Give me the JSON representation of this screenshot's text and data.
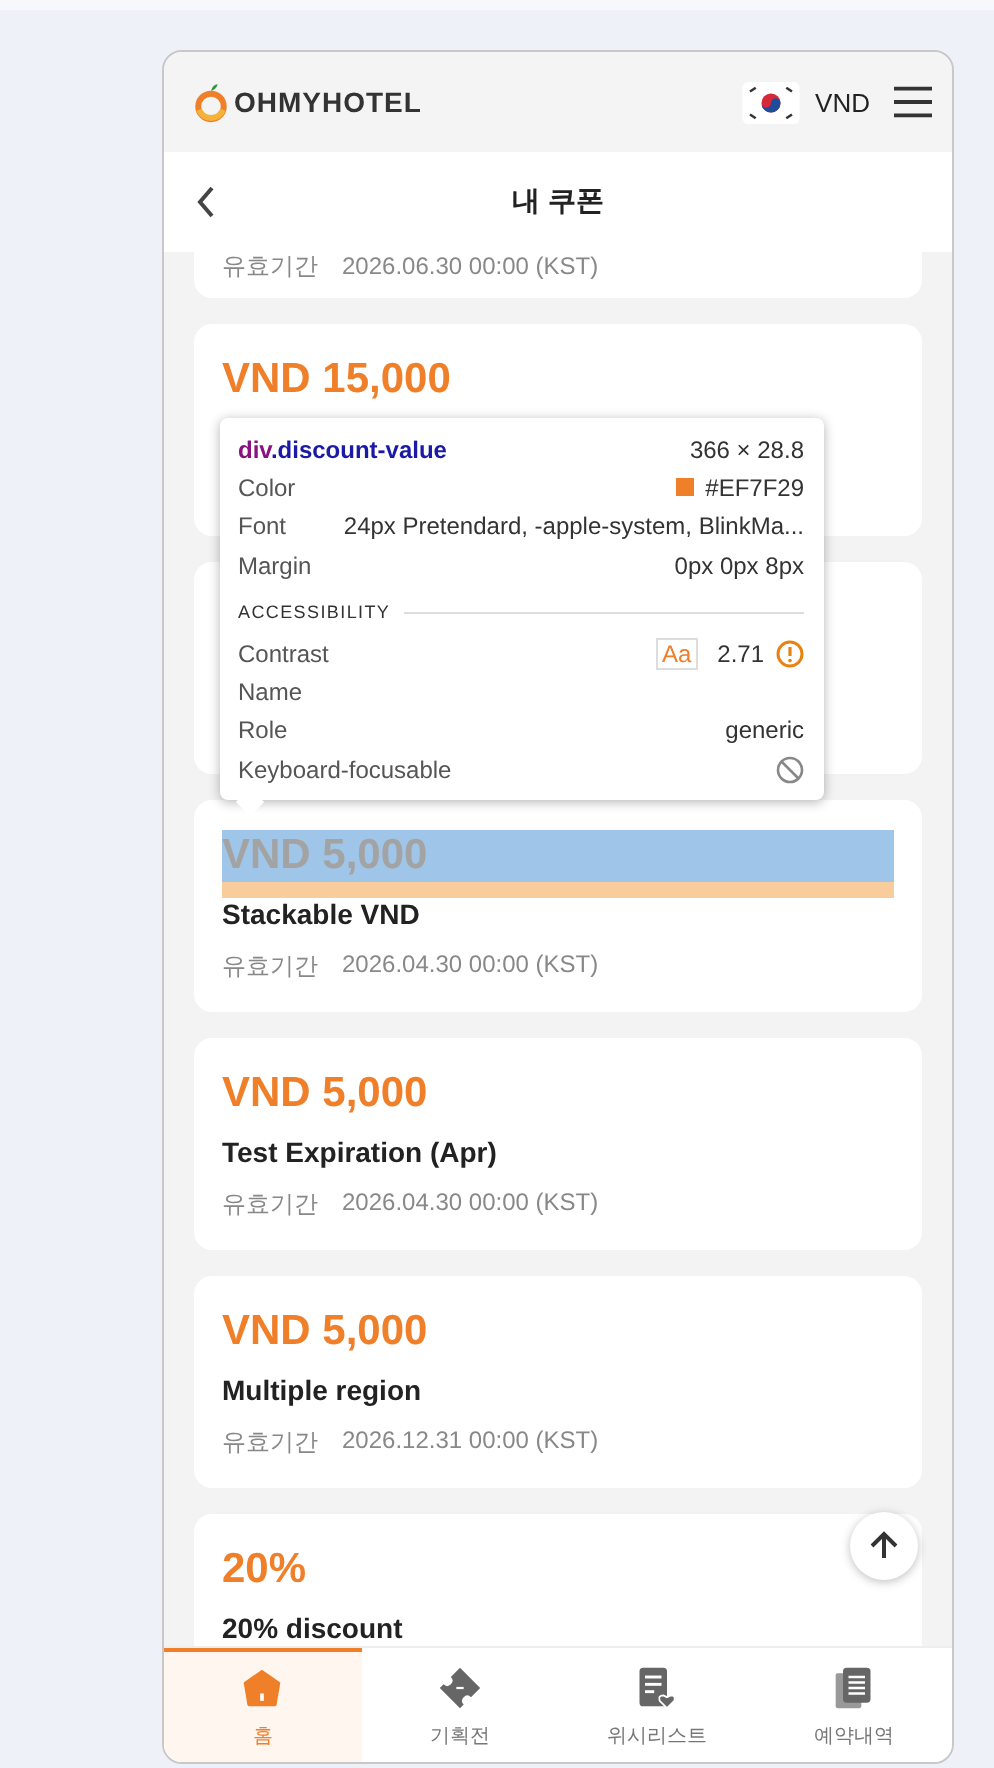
{
  "header": {
    "logo_text": "OHMYHOTEL",
    "currency": "VND"
  },
  "title_bar": {
    "title": "내 쿠폰"
  },
  "coupons": [
    {
      "kind": "cut",
      "validity_label": "유효기간",
      "validity": "2026.06.30 00:00 (KST)"
    },
    {
      "kind": "card",
      "value": "VND 15,000"
    },
    {
      "kind": "card"
    },
    {
      "kind": "card",
      "value": "VND 5,000",
      "highlighted": true,
      "name": "Stackable VND",
      "validity_label": "유효기간",
      "validity": "2026.04.30 00:00 (KST)"
    },
    {
      "kind": "card",
      "value": "VND 5,000",
      "highlighted": false,
      "name": "Test Expiration (Apr)",
      "validity_label": "유효기간",
      "validity": "2026.04.30 00:00 (KST)"
    },
    {
      "kind": "card",
      "value": "VND 5,000",
      "highlighted": false,
      "name": "Multiple region",
      "validity_label": "유효기간",
      "validity": "2026.12.31 00:00 (KST)"
    },
    {
      "kind": "card",
      "value": "20%",
      "highlighted": false,
      "name": "20% discount"
    }
  ],
  "inspector_tooltip": {
    "tag": "div",
    "class_name": ".discount-value",
    "size": "366 × 28.8",
    "rows": [
      {
        "label": "Color",
        "value": "#EF7F29",
        "color": "#ef7f29"
      },
      {
        "label": "Font",
        "value": "24px Pretendard, -apple-system, BlinkMa..."
      },
      {
        "label": "Margin",
        "value": "0px 0px 8px"
      }
    ],
    "section": "ACCESSIBILITY",
    "accessibility": [
      {
        "label": "Contrast",
        "kind": "contrast",
        "badge": "Aa",
        "value": "2.71"
      },
      {
        "label": "Name",
        "kind": "text"
      },
      {
        "label": "Role",
        "kind": "text",
        "value": "generic"
      },
      {
        "label": "Keyboard-focusable",
        "kind": "blocked"
      }
    ]
  },
  "bottom_nav": [
    {
      "label": "홈",
      "kind": "home",
      "selected": true
    },
    {
      "label": "기획전",
      "kind": "ticket",
      "selected": false
    },
    {
      "label": "위시리스트",
      "kind": "wishlist",
      "selected": false
    },
    {
      "label": "예약내역",
      "kind": "bookings",
      "selected": false
    }
  ]
}
